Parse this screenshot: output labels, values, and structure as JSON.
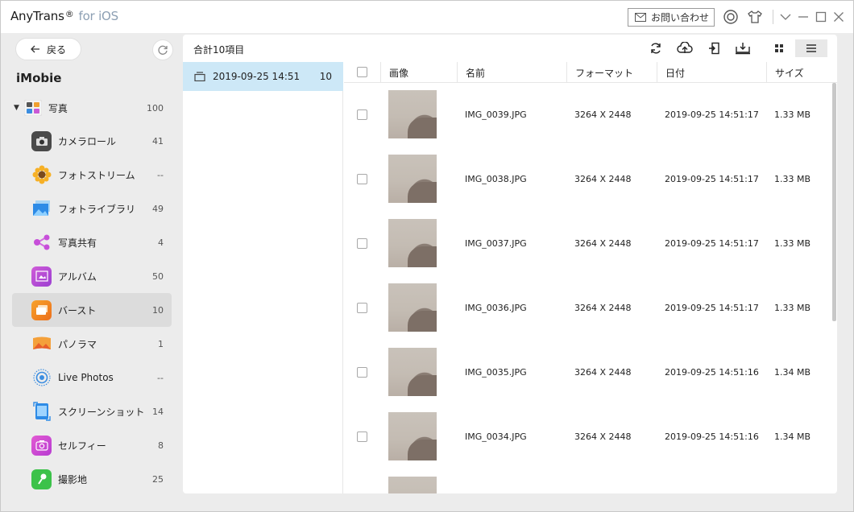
{
  "app": {
    "name": "AnyTrans",
    "reg": "®",
    "subtitle": "for iOS",
    "contact_label": "お問い合わせ"
  },
  "sidebar": {
    "back_label": "戻る",
    "device_name": "iMobie",
    "category": {
      "label": "写真",
      "count": "100"
    },
    "items": [
      {
        "label": "カメラロール",
        "count": "41",
        "icon": "camera-icon"
      },
      {
        "label": "フォトストリーム",
        "count": "--",
        "icon": "sunflower-icon"
      },
      {
        "label": "フォトライブラリ",
        "count": "49",
        "icon": "photo-library-icon"
      },
      {
        "label": "写真共有",
        "count": "4",
        "icon": "share-icon"
      },
      {
        "label": "アルバム",
        "count": "50",
        "icon": "album-icon"
      },
      {
        "label": "バースト",
        "count": "10",
        "icon": "burst-icon"
      },
      {
        "label": "パノラマ",
        "count": "1",
        "icon": "panorama-icon"
      },
      {
        "label": "Live Photos",
        "count": "--",
        "icon": "live-photos-icon"
      },
      {
        "label": "スクリーンショット",
        "count": "14",
        "icon": "screenshot-icon"
      },
      {
        "label": "セルフィー",
        "count": "8",
        "icon": "selfie-icon"
      },
      {
        "label": "撮影地",
        "count": "25",
        "icon": "places-icon"
      }
    ]
  },
  "main": {
    "total_label": "合計10項目",
    "group": {
      "label": "2019-09-25 14:51",
      "count": "10"
    },
    "columns": [
      "画像",
      "名前",
      "フォーマット",
      "日付",
      "サイズ"
    ],
    "rows": [
      {
        "name": "IMG_0039.JPG",
        "format": "3264 X 2448",
        "date": "2019-09-25 14:51:17",
        "size": "1.33 MB"
      },
      {
        "name": "IMG_0038.JPG",
        "format": "3264 X 2448",
        "date": "2019-09-25 14:51:17",
        "size": "1.33 MB"
      },
      {
        "name": "IMG_0037.JPG",
        "format": "3264 X 2448",
        "date": "2019-09-25 14:51:17",
        "size": "1.33 MB"
      },
      {
        "name": "IMG_0036.JPG",
        "format": "3264 X 2448",
        "date": "2019-09-25 14:51:17",
        "size": "1.33 MB"
      },
      {
        "name": "IMG_0035.JPG",
        "format": "3264 X 2448",
        "date": "2019-09-25 14:51:16",
        "size": "1.34 MB"
      },
      {
        "name": "IMG_0034.JPG",
        "format": "3264 X 2448",
        "date": "2019-09-25 14:51:16",
        "size": "1.34 MB"
      },
      {
        "name": "",
        "format": "",
        "date": "",
        "size": ""
      }
    ]
  },
  "colors": {
    "selection_blue": "#cde8f7",
    "sidebar_bg": "#ececec",
    "active_item": "#dcdcdc"
  }
}
